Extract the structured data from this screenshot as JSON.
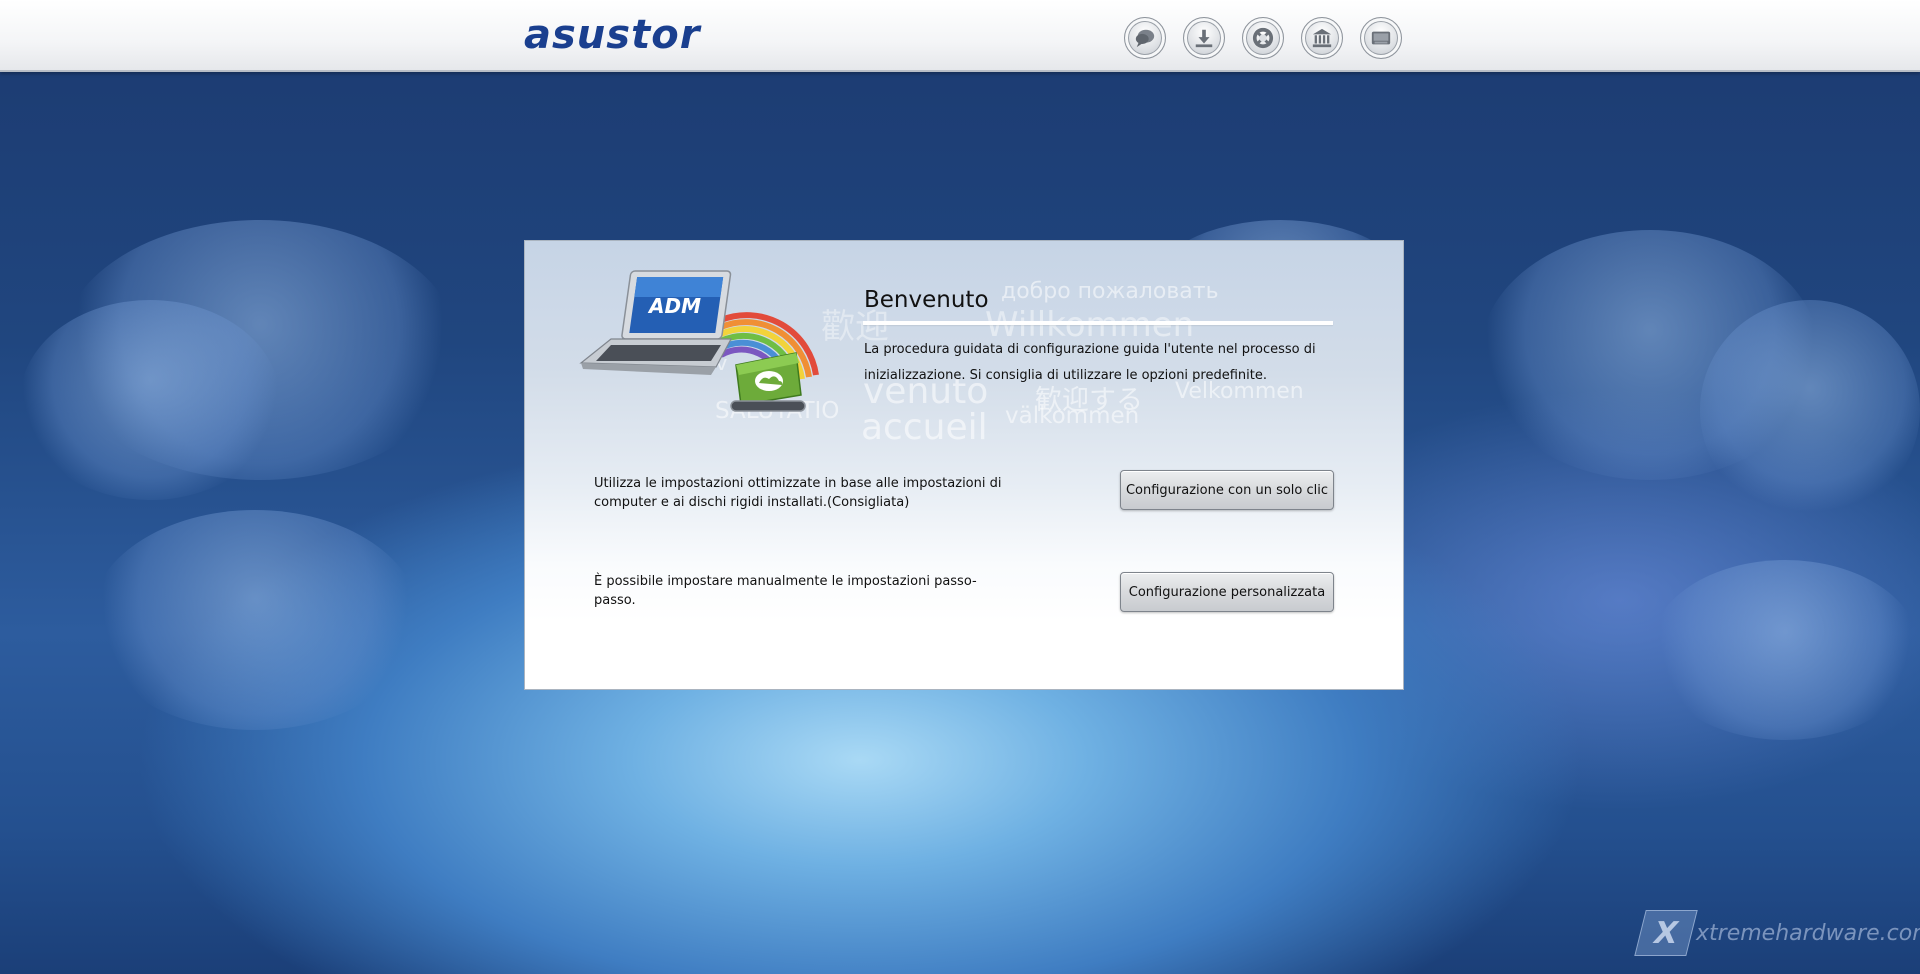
{
  "header": {
    "logo_text": "asustor",
    "icons": [
      "chat-bubble-icon",
      "download-icon",
      "support-lifebuoy-icon",
      "institution-icon",
      "keyboard-icon"
    ]
  },
  "dialog": {
    "title": "Benvenuto",
    "intro": "La procedura guidata di configurazione guida l'utente nel processo di inizializzazione. Si consiglia di utilizzare le opzioni predefinite.",
    "hero_screen_text": "ADM",
    "watermark_words": {
      "w1": "добро пожаловать",
      "w2": "歡迎",
      "w3": "Willkommen",
      "w4": "venuto",
      "w5": "歓迎する",
      "w6": "Velkommen",
      "w7": "accueil",
      "w8": "välkommen",
      "w9": "SALUTATIO",
      "w10": "ienv"
    },
    "options": [
      {
        "description": "Utilizza le impostazioni ottimizzate in base alle impostazioni di computer e ai dischi rigidi installati.(Consigliata)",
        "button_label": "Configurazione con un solo clic"
      },
      {
        "description": "È possibile impostare manualmente le impostazioni passo-passo.",
        "button_label": "Configurazione personalizzata"
      }
    ]
  },
  "site_watermark": {
    "glyph": "X",
    "text": "xtremehardware.com"
  },
  "colors": {
    "brand_blue": "#1a3f8f",
    "brand_green": "#8fc43e",
    "background_dark": "#1c3a70",
    "background_light": "#a9d9f5"
  }
}
